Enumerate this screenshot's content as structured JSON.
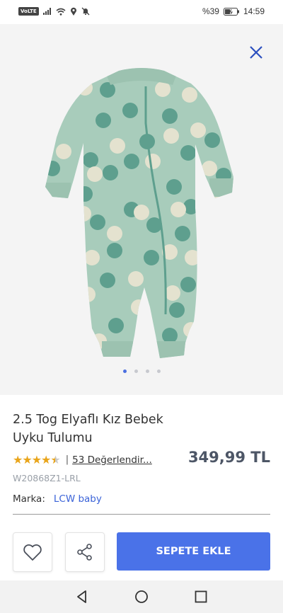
{
  "status_bar": {
    "network_badge": "VoLTE",
    "battery": "%39",
    "time": "14:59"
  },
  "gallery": {
    "image_count": 4,
    "active_index": 0
  },
  "product": {
    "title": "2.5 Tog Elyaflı Kız Bebek Uyku Tulumu",
    "stars": "★★★★★",
    "rating_value": 4.5,
    "separator": "|",
    "reviews_label": "53 Değerlendir...",
    "price": "349,99 TL",
    "sku": "W20868Z1-LRL",
    "brand_label": "Marka:",
    "brand_name": "LCW baby"
  },
  "actions": {
    "add_to_cart_label": "SEPETE EKLE"
  },
  "colors": {
    "accent": "#4a72e8",
    "star": "#e9a51b",
    "price": "#4d5666",
    "garment": "#a8ccbb",
    "dot_dark": "#5e9f8e",
    "dot_light": "#e4e2cf"
  },
  "icons": {
    "close": "close-icon",
    "favorite": "heart-icon",
    "share": "share-icon",
    "nav_back": "triangle-back-icon",
    "nav_home": "circle-home-icon",
    "nav_recents": "square-recents-icon"
  }
}
